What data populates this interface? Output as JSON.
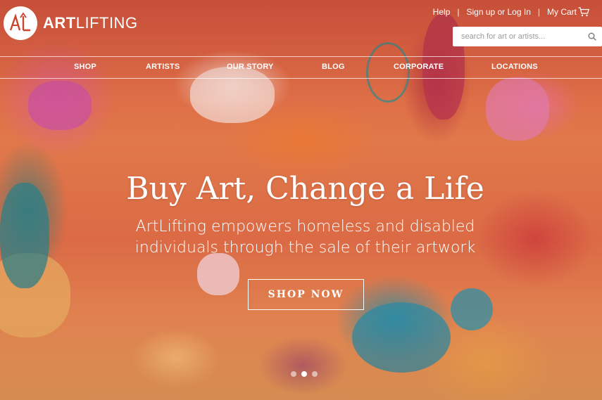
{
  "brand": {
    "name_bold": "ART",
    "name_rest": "LIFTING",
    "logo_alt": "AL"
  },
  "util_links": {
    "help": "Help",
    "signup": "Sign up or Log In",
    "cart": "My Cart"
  },
  "search": {
    "placeholder": "search for art or artists..."
  },
  "nav": {
    "items": [
      {
        "label": "SHOP"
      },
      {
        "label": "ARTISTS"
      },
      {
        "label": "OUR STORY"
      },
      {
        "label": "BLOG"
      },
      {
        "label": "CORPORATE"
      },
      {
        "label": "LOCATIONS"
      }
    ]
  },
  "hero": {
    "headline": "Buy Art, Change a Life",
    "subline_1": "ArtLifting empowers homeless and disabled",
    "subline_2": "individuals through the sale of their artwork",
    "cta": "SHOP NOW",
    "carousel_active_index": 2,
    "carousel_count": 3
  },
  "colors": {
    "accent_logo": "#c8452e",
    "text": "#ffffff"
  }
}
